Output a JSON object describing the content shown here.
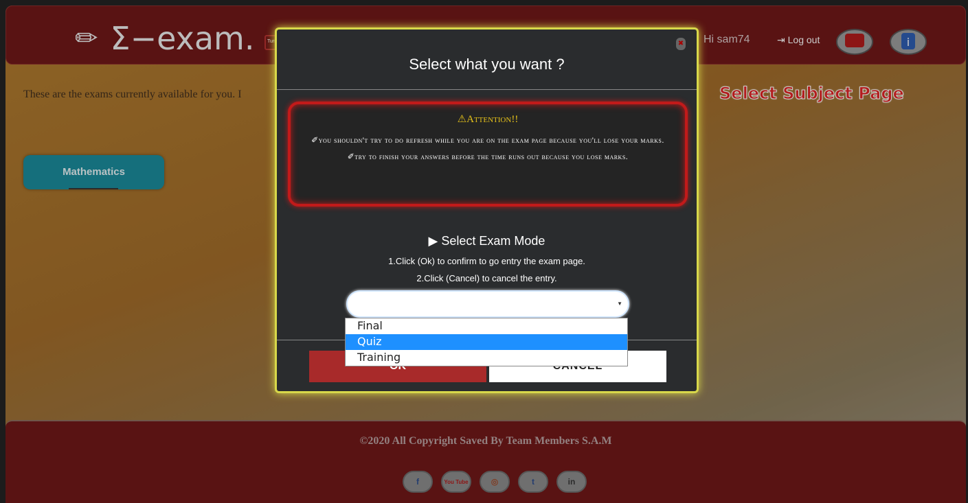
{
  "app": {
    "logo_text": "Σ−exam.",
    "turn_button_label": "Turn"
  },
  "header": {
    "greeting": "Hi sam74",
    "logout_label": "Log out",
    "icons": [
      "chat-icon",
      "info-icon"
    ]
  },
  "main": {
    "intro_text": "These are the exams currently available for you. I",
    "subject_button": "Mathematics",
    "page_label": "Select Subject Page"
  },
  "modal": {
    "title": "Select what you want ?",
    "attention_title": "⚠Attention!!",
    "attention_lines": [
      "✐You shouldn't try to do refresh while you are on the exam page because you'll lose your marks.",
      "✐Try to finish your answers before the time runs out because you lose marks."
    ],
    "mode_title": "▶ Select Exam Mode",
    "instructions": [
      "1.Click (Ok) to confirm to go entry the exam page.",
      "2.Click (Cancel) to cancel the entry."
    ],
    "select_value": "",
    "options": [
      "Final",
      "Quiz",
      "Training"
    ],
    "highlighted_option": "Quiz",
    "ok_label": "OK",
    "cancel_label": "CANCEL"
  },
  "footer": {
    "copyright": "©2020 All Copyright Saved By Team Members S.A.M",
    "socials": [
      "facebook-icon",
      "youtube-icon",
      "instagram-icon",
      "twitter-icon",
      "linkedin-icon"
    ],
    "social_glyphs": [
      "f",
      "You Tube",
      "◎",
      "t",
      "in"
    ]
  },
  "colors": {
    "header_bg": "#6e1414",
    "modal_border": "#d8d84a",
    "attention_border": "#c21a1a",
    "ok_button": "#a82a2a",
    "highlight": "#1e90ff"
  }
}
